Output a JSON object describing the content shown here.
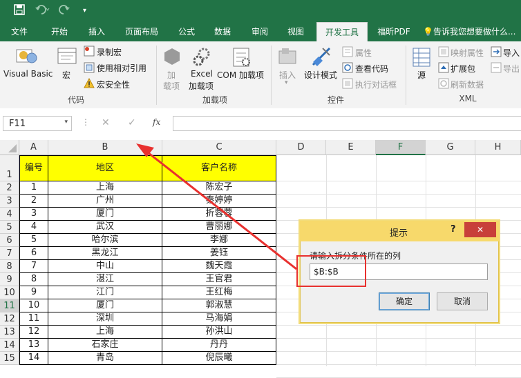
{
  "titlebar": {
    "save_icon": "save-icon",
    "undo_icon": "undo-icon",
    "redo_icon": "redo-icon"
  },
  "tabs": [
    {
      "label": "文件"
    },
    {
      "label": "开始"
    },
    {
      "label": "插入"
    },
    {
      "label": "页面布局"
    },
    {
      "label": "公式"
    },
    {
      "label": "数据"
    },
    {
      "label": "审阅"
    },
    {
      "label": "视图"
    },
    {
      "label": "开发工具"
    },
    {
      "label": "福昕PDF"
    }
  ],
  "tell_me": "告诉我您想要做什么...",
  "ribbon": {
    "visual_basic": "Visual Basic",
    "macro": "宏",
    "record_macro": "录制宏",
    "relative_ref": "使用相对引用",
    "macro_security": "宏安全性",
    "group_code": "代码",
    "addins_1": "加",
    "addins_2": "载项",
    "excel_addins_1": "Excel",
    "excel_addins_2": "加载项",
    "com_addins": "COM 加载项",
    "group_addins": "加载项",
    "insert": "插入",
    "design_mode": "设计模式",
    "properties": "属性",
    "view_code": "查看代码",
    "run_dialog": "执行对话框",
    "group_controls": "控件",
    "source": "源",
    "map_props": "映射属性",
    "expansion": "扩展包",
    "refresh": "刷新数据",
    "import": "导入",
    "export": "导出",
    "group_xml": "XML"
  },
  "formula_bar": {
    "name_box": "F11",
    "fx": "fx",
    "cancel": "✕",
    "confirm": "✓"
  },
  "columns": [
    "A",
    "B",
    "C",
    "D",
    "E",
    "F",
    "G",
    "H"
  ],
  "header_row": [
    "编号",
    "地区",
    "客户名称"
  ],
  "rows": [
    [
      "1",
      "上海",
      "陈宏子"
    ],
    [
      "2",
      "广州",
      "秦婷婷"
    ],
    [
      "3",
      "厦门",
      "折蓉蓉"
    ],
    [
      "4",
      "武汉",
      "曹丽娜"
    ],
    [
      "5",
      "哈尔滨",
      "李娜"
    ],
    [
      "6",
      "黑龙江",
      "姜钰"
    ],
    [
      "7",
      "中山",
      "魏天霞"
    ],
    [
      "8",
      "湛江",
      "王官君"
    ],
    [
      "9",
      "江门",
      "王红梅"
    ],
    [
      "10",
      "厦门",
      "郭淑慧"
    ],
    [
      "11",
      "深圳",
      "马海娟"
    ],
    [
      "12",
      "上海",
      "孙洪山"
    ],
    [
      "13",
      "石家庄",
      "丹丹"
    ],
    [
      "14",
      "青岛",
      "倪辰曦"
    ]
  ],
  "row_numbers": [
    "1",
    "2",
    "3",
    "4",
    "5",
    "6",
    "7",
    "8",
    "9",
    "10",
    "11",
    "12",
    "13",
    "14",
    "15"
  ],
  "dialog": {
    "title": "提示",
    "help": "?",
    "close": "✕",
    "prompt": "请输入拆分条件所在的列",
    "value": "$B:$B",
    "ok": "确定",
    "cancel": "取消"
  },
  "colors": {
    "accent": "#217346",
    "header_fill": "#ffff00",
    "annotation": "#e8312f"
  }
}
